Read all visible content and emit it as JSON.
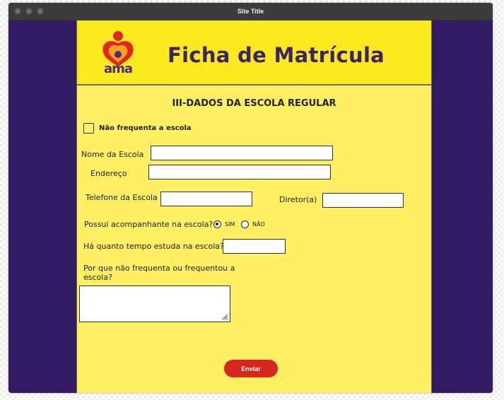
{
  "window": {
    "title": "Site Title"
  },
  "header": {
    "logo_text": "ama",
    "title": "Ficha de Matrícula"
  },
  "section": {
    "title": "III-DADOS DA ESCOLA REGULAR"
  },
  "form": {
    "not_attending_label": "Não frequenta a escola",
    "school_name_label": "Nome da Escola",
    "address_label": "Endereço",
    "school_phone_label": "Telefone da Escola",
    "principal_label": "Diretor(a)",
    "companion_question": "Possui acompanhante na escola?",
    "companion_options": [
      {
        "label": "SIM",
        "selected": true
      },
      {
        "label": "NÃO",
        "selected": false
      }
    ],
    "time_question": "Há quanto tempo estuda na escola?",
    "why_question": "Por que não frequenta ou frequentou a escola?",
    "submit_label": "Enviar"
  },
  "colors": {
    "page_bg": "#ffef63",
    "banner_bg": "#fbe81f",
    "side_bg": "#321b62",
    "title_color": "#3a2468",
    "button": "#d8251e"
  }
}
